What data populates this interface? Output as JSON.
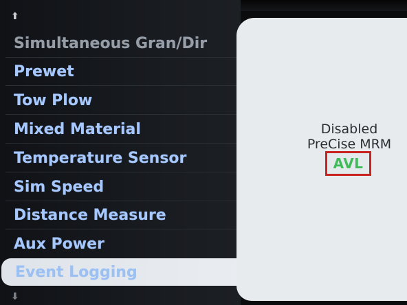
{
  "menu": {
    "items": [
      {
        "label": "Simultaneous Gran/Dir"
      },
      {
        "label": "Prewet"
      },
      {
        "label": "Tow Plow"
      },
      {
        "label": "Mixed Material"
      },
      {
        "label": "Temperature Sensor"
      },
      {
        "label": "Sim Speed"
      },
      {
        "label": "Distance Measure"
      },
      {
        "label": "Aux Power"
      },
      {
        "label": "Event Logging"
      }
    ],
    "up_arrow": "⬆",
    "down_arrow": "⬇"
  },
  "panel": {
    "status_line1": "Disabled",
    "status_line2": "PreCise MRM",
    "highlight_label": "AVL"
  },
  "colors": {
    "menu_text": "#a6c8ff",
    "panel_bg": "#e7ebee",
    "highlight_border": "#c8231e",
    "highlight_text": "#3fbb5a"
  }
}
